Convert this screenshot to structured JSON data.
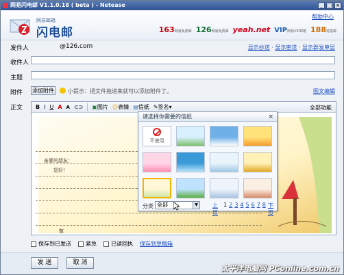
{
  "window": {
    "title": "网易闪电邮 V1.1.0.18 ( beta ) - Netease"
  },
  "header": {
    "brand_sub": "网易邮箱",
    "brand": "闪电邮",
    "help": "帮助中心",
    "partners": [
      {
        "name": "163",
        "sub": "网易免费邮"
      },
      {
        "name": "126",
        "sub": "网易免费邮"
      },
      {
        "name": "yeah.net",
        "sub": ""
      },
      {
        "name": "VIP",
        "sub": "网易VIP邮箱"
      },
      {
        "name": "188",
        "sub": "财富邮"
      }
    ]
  },
  "form": {
    "from_label": "发件人",
    "from_value": "@126.com",
    "links": [
      "显示抄送",
      "显示密送",
      "显示群发单显"
    ],
    "to_label": "收件人",
    "subject_label": "主题",
    "attach_label": "附件",
    "attach_button": "添加附件",
    "attach_tip": "小提示：把文件拖进来就可以添加附件了。",
    "embed_link": "图文编辑",
    "body_label": "正文"
  },
  "toolbar": {
    "bold": "B",
    "italic": "I",
    "underline": "U",
    "color": "A",
    "size": "A",
    "image": "图片",
    "emoji": "表情",
    "stationery": "信纸",
    "signature": "签名",
    "full": "全部功能"
  },
  "letter": {
    "greeting": "亲爱的朋友：",
    "line1": "您好！",
    "closing": "敬"
  },
  "stationery_popup": {
    "title": "请选择你需要的信纸",
    "no_use": "不使用",
    "thumbs": [
      {
        "kind": "none",
        "colors": [
          "#ffffff",
          "#ffffff"
        ]
      },
      {
        "kind": "flowers",
        "colors": [
          "#d8f0ff",
          "#7cc06a"
        ]
      },
      {
        "kind": "sky",
        "colors": [
          "#6fb0e8",
          "#ffffff"
        ]
      },
      {
        "kind": "sunset",
        "colors": [
          "#ffe27a",
          "#f59c2a"
        ]
      },
      {
        "kind": "pink",
        "colors": [
          "#ffd6e6",
          "#ff8fb3"
        ]
      },
      {
        "kind": "sea",
        "colors": [
          "#3a9ad8",
          "#b7e2f8"
        ]
      },
      {
        "kind": "snow",
        "colors": [
          "#eaf4fb",
          "#9fc8e6"
        ]
      },
      {
        "kind": "field",
        "colors": [
          "#fff1b8",
          "#e3a825"
        ]
      },
      {
        "kind": "tree",
        "colors": [
          "#fff7d6",
          "#cfe7a8"
        ]
      },
      {
        "kind": "meadow",
        "colors": [
          "#bfe3ff",
          "#5cae45"
        ]
      },
      {
        "kind": "lined",
        "colors": [
          "#eef4fb",
          "#a9c4e2"
        ]
      },
      {
        "kind": "frame",
        "colors": [
          "#fbeee2",
          "#d88a6a"
        ]
      }
    ],
    "category_label": "分类",
    "category_value": "全部",
    "pager": {
      "prev": "上页",
      "pages": [
        "1",
        "2",
        "3",
        "4",
        "5",
        "6",
        "7",
        "8"
      ],
      "next": "下页",
      "current": "1"
    }
  },
  "options": {
    "save_sent": "保存到已发送",
    "urgent": "紧急",
    "read_receipt": "已读回执",
    "save_draft": "保存到草稿箱"
  },
  "buttons": {
    "send": "发 送",
    "cancel": "取 消"
  },
  "watermark": "太平洋电脑网 PConline.com.cn"
}
